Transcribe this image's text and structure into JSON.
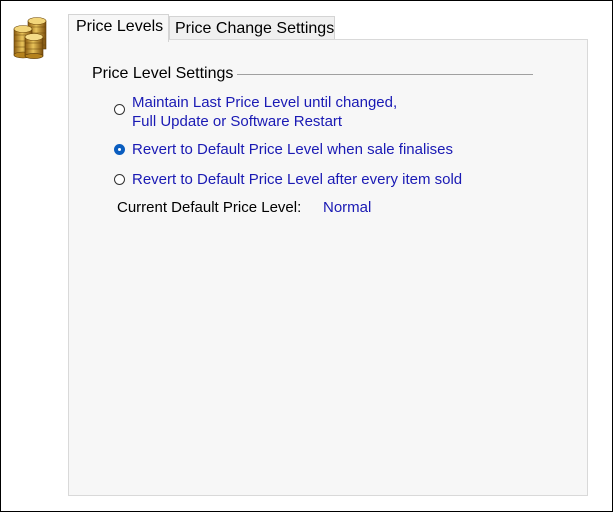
{
  "tabs": [
    {
      "label": "Price Levels",
      "active": true
    },
    {
      "label": "Price Change Settings",
      "active": false
    }
  ],
  "group": {
    "title": "Price Level Settings"
  },
  "options": [
    {
      "line1": "Maintain Last Price Level until changed,",
      "line2": "Full Update or Software Restart",
      "selected": false
    },
    {
      "line1": "Revert to Default Price Level  when sale finalises",
      "selected": true
    },
    {
      "line1": "Revert to Default Price Level after every item sold",
      "selected": false
    }
  ],
  "current_default": {
    "label": "Current Default Price Level:",
    "value": "Normal"
  },
  "colors": {
    "link_text": "#1a1ab4",
    "radio_selected": "#0a5dbf",
    "panel_bg": "#f7f7f7"
  },
  "icons": {
    "app_icon": "gold-coins-icon"
  }
}
